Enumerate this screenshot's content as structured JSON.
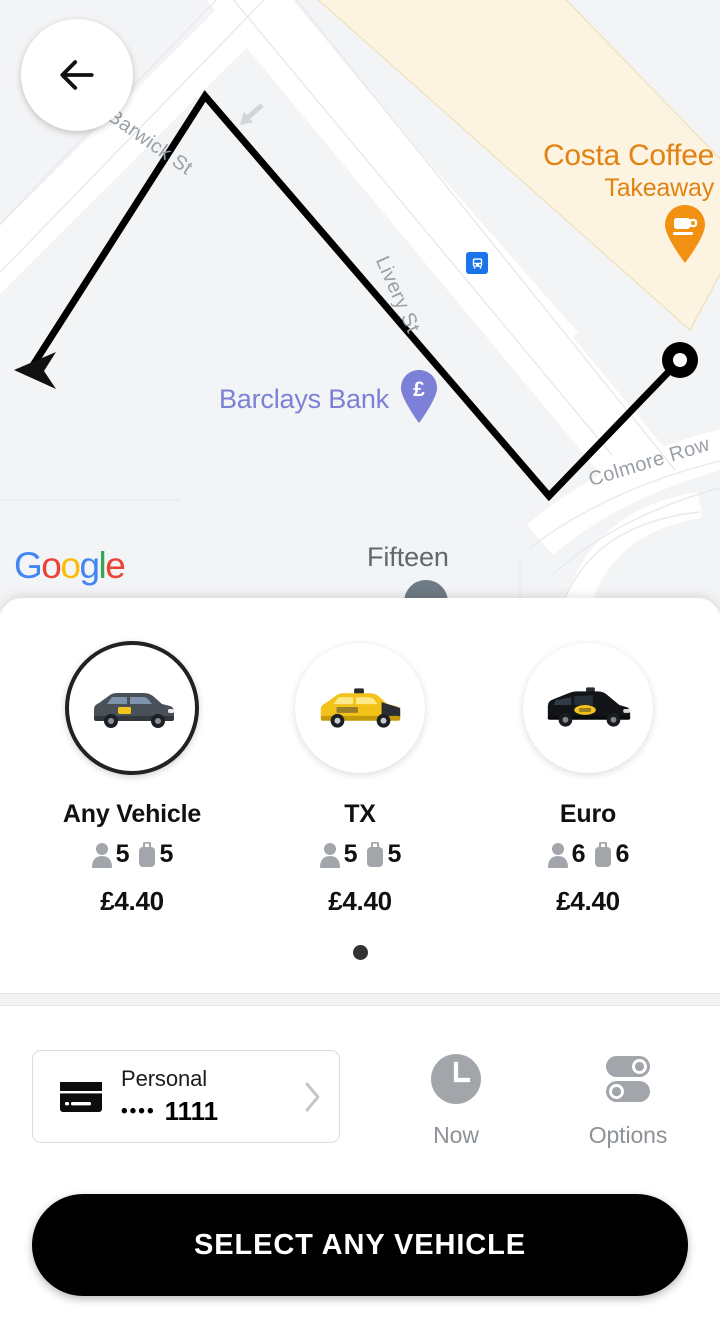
{
  "map": {
    "back_button_icon": "arrow-left-icon",
    "attribution": "Google",
    "attribution_letters": [
      "G",
      "o",
      "o",
      "g",
      "l",
      "e"
    ],
    "pois": [
      {
        "name": "Costa Coffee",
        "subtitle": "Takeaway",
        "icon": "coffee-cup-pin-icon",
        "color": "#E08214"
      },
      {
        "name": "Barclays Bank",
        "icon": "pound-bank-pin-icon",
        "color": "#7C80D6"
      },
      {
        "name": "Fifteen",
        "color": "#62686E"
      }
    ],
    "streets": [
      "Barwick St",
      "Livery St",
      "Colmore Row"
    ],
    "transit_icon": "bus-stop-icon",
    "route": {
      "origin_marker": "ring-marker-icon",
      "destination_marker": "arrow-head-marker-icon",
      "line_color": "#000000"
    }
  },
  "sheet": {
    "vehicles": [
      {
        "name": "Any Vehicle",
        "passengers": "5",
        "luggage": "5",
        "price": "£4.40",
        "selected": true,
        "vehicle_icon": "grey-london-taxi-icon"
      },
      {
        "name": "TX",
        "passengers": "5",
        "luggage": "5",
        "price": "£4.40",
        "selected": false,
        "vehicle_icon": "yellow-taxi-icon"
      },
      {
        "name": "Euro",
        "passengers": "6",
        "luggage": "6",
        "price": "£4.40",
        "selected": false,
        "vehicle_icon": "black-minivan-taxi-icon"
      }
    ],
    "pagination": {
      "pages": 1,
      "active": 0
    }
  },
  "booking": {
    "payment": {
      "label": "Personal",
      "masked_dots": "••••",
      "last_four": "1111",
      "card_icon": "credit-card-icon",
      "chevron_icon": "chevron-right-icon"
    },
    "time": {
      "label": "Now",
      "icon": "clock-icon"
    },
    "options": {
      "label": "Options",
      "icon": "toggles-icon"
    }
  },
  "cta": {
    "label": "SELECT ANY VEHICLE"
  },
  "colors": {
    "accent_black": "#000000",
    "map_bg": "#f3f4f6",
    "costa_orange": "#E08214",
    "barclays_purple": "#7C80D6",
    "transit_blue": "#1A73E8",
    "muted_grey": "#8d9296"
  }
}
